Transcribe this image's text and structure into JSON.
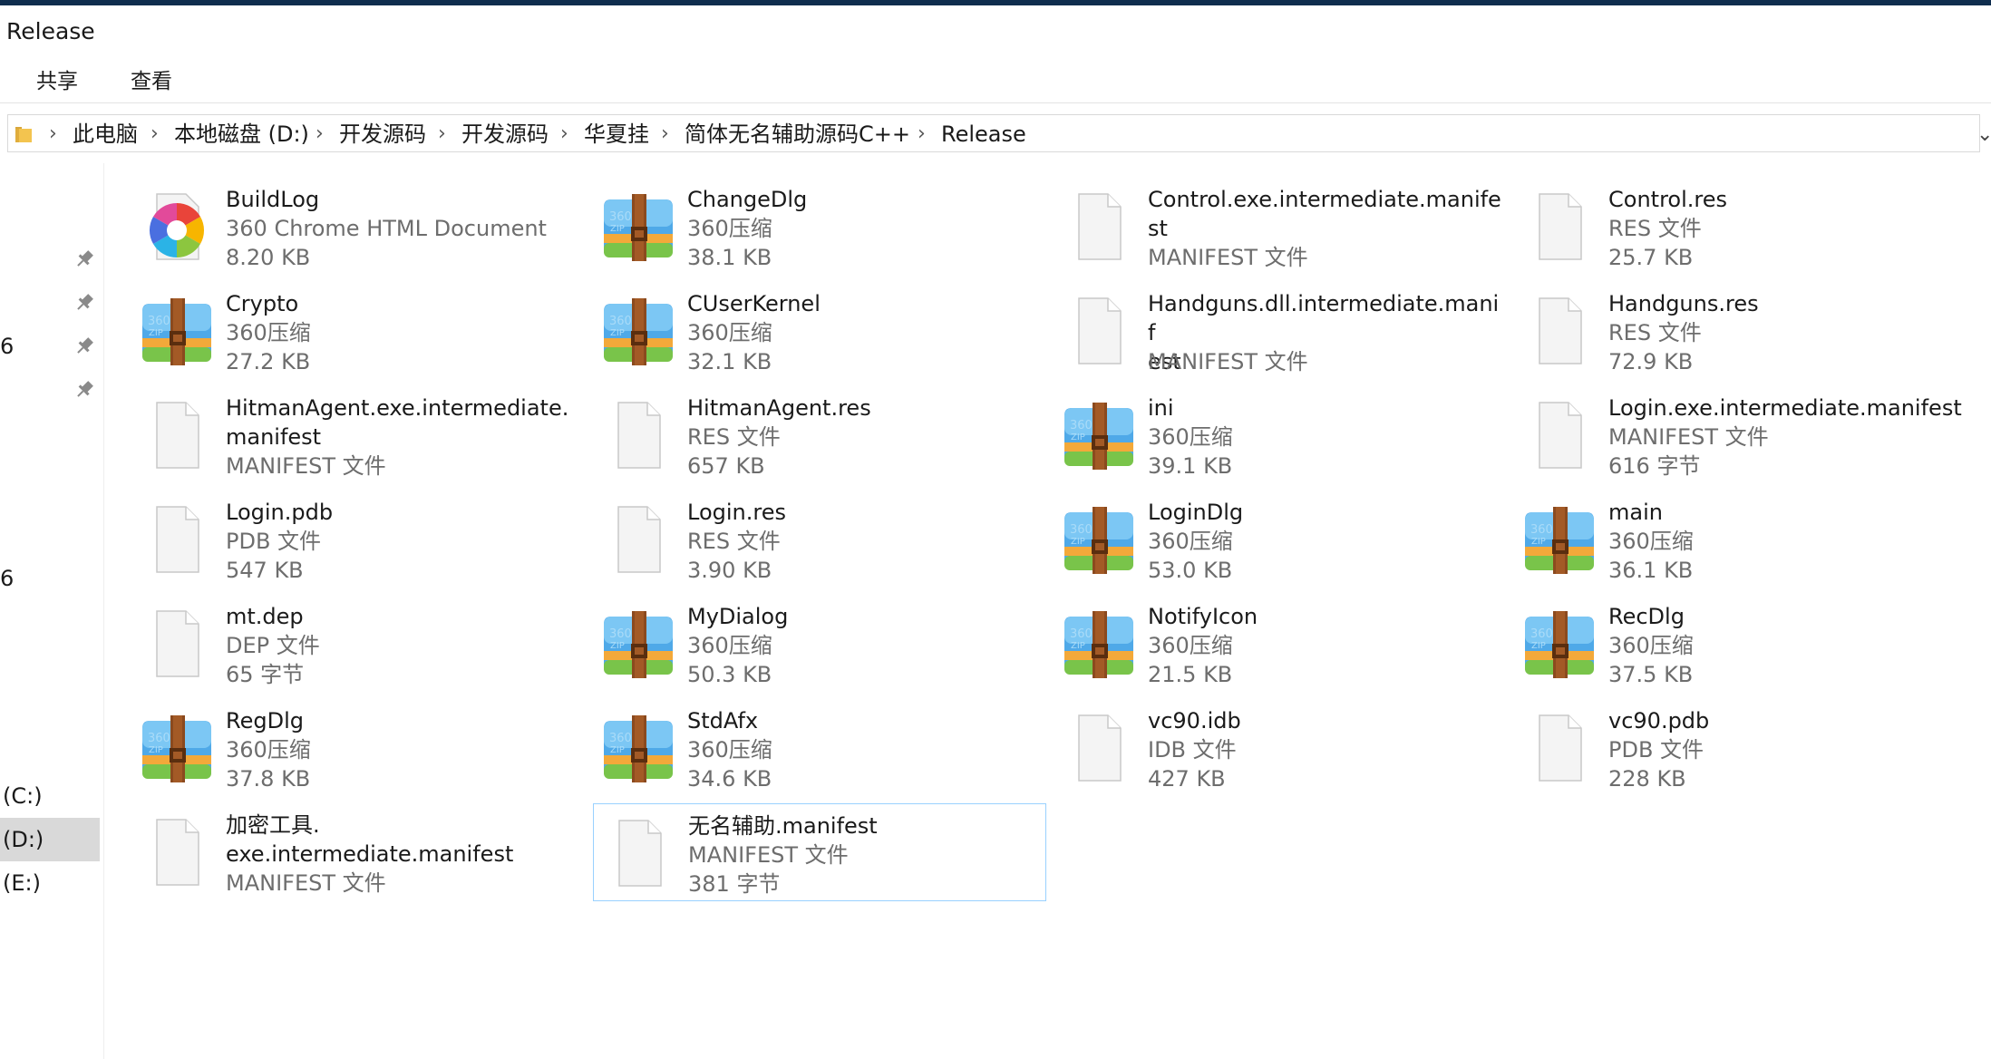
{
  "window": {
    "title": "Release"
  },
  "ribbon": {
    "tabs": [
      "共享",
      "查看"
    ]
  },
  "breadcrumb": [
    "此电脑",
    "本地磁盘 (D:)",
    "开发源码",
    "开发源码",
    "华夏挂",
    "简体无名辅助源码C++",
    "Release"
  ],
  "nav": {
    "fragments": [
      "6",
      "6"
    ],
    "drives": [
      "(C:)",
      "(D:)",
      "(E:)"
    ]
  },
  "colors": {
    "title_bar": "#0f2d4e",
    "selection_border": "#99d1ff",
    "nav_selected": "#d9d9d9",
    "secondary_text": "#6d6d6d"
  },
  "files": [
    {
      "name": "BuildLog",
      "type": "360 Chrome HTML Document",
      "size": "8.20 KB",
      "icon": "chrome-360-icon"
    },
    {
      "name": "ChangeDlg",
      "type": "360压缩",
      "size": "38.1 KB",
      "icon": "zip-360-icon"
    },
    {
      "name": "Control.exe.intermediate.manife\nst",
      "type": "MANIFEST 文件",
      "size": "",
      "icon": "generic-file-icon"
    },
    {
      "name": "Control.res",
      "type": "RES 文件",
      "size": "25.7 KB",
      "icon": "generic-file-icon"
    },
    {
      "name": "Crypto",
      "type": "360压缩",
      "size": "27.2 KB",
      "icon": "zip-360-icon"
    },
    {
      "name": "CUserKernel",
      "type": "360压缩",
      "size": "32.1 KB",
      "icon": "zip-360-icon"
    },
    {
      "name": "Handguns.dll.intermediate.manif\nest",
      "type": "MANIFEST 文件",
      "size": "",
      "icon": "generic-file-icon"
    },
    {
      "name": "Handguns.res",
      "type": "RES 文件",
      "size": "72.9 KB",
      "icon": "generic-file-icon"
    },
    {
      "name": "HitmanAgent.exe.intermediate.\nmanifest",
      "type": "MANIFEST 文件",
      "size": "",
      "icon": "generic-file-icon"
    },
    {
      "name": "HitmanAgent.res",
      "type": "RES 文件",
      "size": "657 KB",
      "icon": "generic-file-icon"
    },
    {
      "name": "ini",
      "type": "360压缩",
      "size": "39.1 KB",
      "icon": "zip-360-icon"
    },
    {
      "name": "Login.exe.intermediate.manifest",
      "type": "MANIFEST 文件",
      "size": "616 字节",
      "icon": "generic-file-icon"
    },
    {
      "name": "Login.pdb",
      "type": "PDB 文件",
      "size": "547 KB",
      "icon": "generic-file-icon"
    },
    {
      "name": "Login.res",
      "type": "RES 文件",
      "size": "3.90 KB",
      "icon": "generic-file-icon"
    },
    {
      "name": "LoginDlg",
      "type": "360压缩",
      "size": "53.0 KB",
      "icon": "zip-360-icon"
    },
    {
      "name": "main",
      "type": "360压缩",
      "size": "36.1 KB",
      "icon": "zip-360-icon"
    },
    {
      "name": "mt.dep",
      "type": "DEP 文件",
      "size": "65 字节",
      "icon": "generic-file-icon"
    },
    {
      "name": "MyDialog",
      "type": "360压缩",
      "size": "50.3 KB",
      "icon": "zip-360-icon"
    },
    {
      "name": "NotifyIcon",
      "type": "360压缩",
      "size": "21.5 KB",
      "icon": "zip-360-icon"
    },
    {
      "name": "RecDlg",
      "type": "360压缩",
      "size": "37.5 KB",
      "icon": "zip-360-icon"
    },
    {
      "name": "RegDlg",
      "type": "360压缩",
      "size": "37.8 KB",
      "icon": "zip-360-icon"
    },
    {
      "name": "StdAfx",
      "type": "360压缩",
      "size": "34.6 KB",
      "icon": "zip-360-icon"
    },
    {
      "name": "vc90.idb",
      "type": "IDB 文件",
      "size": "427 KB",
      "icon": "generic-file-icon"
    },
    {
      "name": "vc90.pdb",
      "type": "PDB 文件",
      "size": "228 KB",
      "icon": "generic-file-icon"
    },
    {
      "name": "加密工具.\nexe.intermediate.manifest",
      "type": "MANIFEST 文件",
      "size": "",
      "icon": "generic-file-icon"
    },
    {
      "name": "无名辅助.manifest",
      "type": "MANIFEST 文件",
      "size": "381 字节",
      "icon": "generic-file-icon",
      "selected": true
    }
  ]
}
